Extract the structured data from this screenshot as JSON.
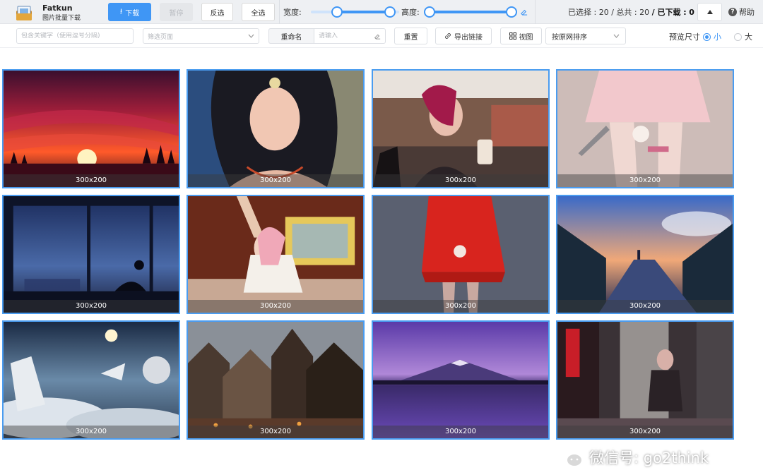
{
  "app": {
    "name": "Fatkun",
    "subtitle": "图片批量下载"
  },
  "toolbar": {
    "download_label": "下载",
    "pause_label": "暂停",
    "invert_label": "反选",
    "select_all_label": "全选",
    "width_label": "宽度:",
    "height_label": "高度:",
    "width_range": [
      0.27,
      0.95
    ],
    "height_range": [
      0.0,
      1.0
    ],
    "selected_label": "已选择 :",
    "selected": "20",
    "total_label": "/ 总共 :",
    "total": "20",
    "downloaded_label": "/ 已下载 :",
    "downloaded": "0",
    "help_label": "帮助"
  },
  "filters": {
    "keyword_placeholder": "包含关键字（使用逗号分隔)",
    "page_filter_placeholder": "筛选页面",
    "rename_label": "重命名",
    "rename_placeholder": "请输入",
    "reset_label": "重置",
    "export_label": "导出链接",
    "view_label": "视图",
    "sort_label": "按原网排序",
    "preview_label": "预览尺寸",
    "size_small": "小",
    "size_large": "大"
  },
  "images": [
    {
      "caption": "300x200",
      "theme": "sunset"
    },
    {
      "caption": "300x200",
      "theme": "girl-jewels"
    },
    {
      "caption": "300x200",
      "theme": "market-girl"
    },
    {
      "caption": "300x200",
      "theme": "pink-dress"
    },
    {
      "caption": "300x200",
      "theme": "city-window"
    },
    {
      "caption": "300x200",
      "theme": "anime-room"
    },
    {
      "caption": "300x200",
      "theme": "red-hoodie"
    },
    {
      "caption": "300x200",
      "theme": "evening-walkway"
    },
    {
      "caption": "300x200",
      "theme": "sky-sea"
    },
    {
      "caption": "300x200",
      "theme": "castle-town"
    },
    {
      "caption": "300x200",
      "theme": "purple-mountain"
    },
    {
      "caption": "300x200",
      "theme": "neon-street"
    }
  ],
  "watermark": {
    "text": "微信号: go2think"
  },
  "colors": {
    "accent": "#3f96f5",
    "card_border": "#4a9cf0"
  }
}
